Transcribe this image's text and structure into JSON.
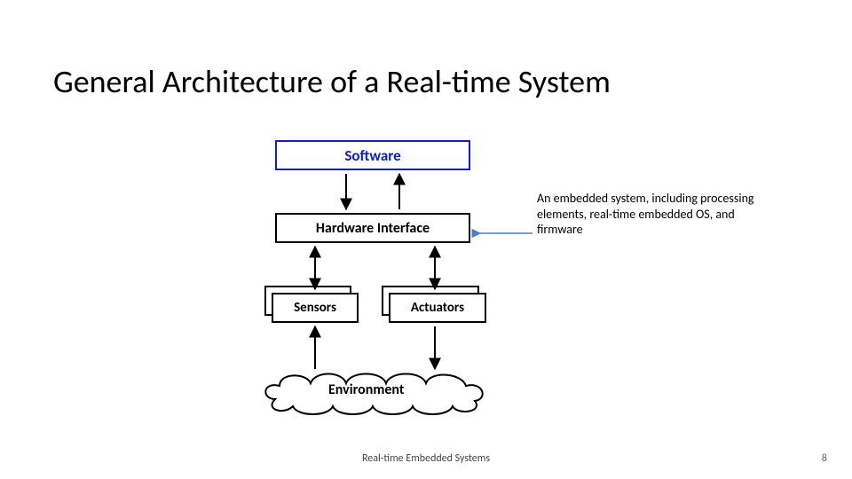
{
  "title": "General Architecture of a Real-time System",
  "nodes": {
    "software": "Software",
    "hardware_interface": "Hardware Interface",
    "sensors": "Sensors",
    "actuators": "Actuators",
    "environment": "Environment"
  },
  "annotation": "An embedded system, including processing elements, real-time embedded OS, and firmware",
  "footer": "Real-time Embedded Systems",
  "page_number": "8",
  "edges": [
    {
      "from": "software",
      "to": "hardware_interface",
      "dir": "both"
    },
    {
      "from": "hardware_interface",
      "to": "sensors",
      "dir": "both"
    },
    {
      "from": "hardware_interface",
      "to": "actuators",
      "dir": "both"
    },
    {
      "from": "sensors",
      "to": "environment",
      "dir": "from_env"
    },
    {
      "from": "actuators",
      "to": "environment",
      "dir": "to_env"
    },
    {
      "from": "annotation",
      "to": "hardware_interface",
      "dir": "to"
    }
  ]
}
